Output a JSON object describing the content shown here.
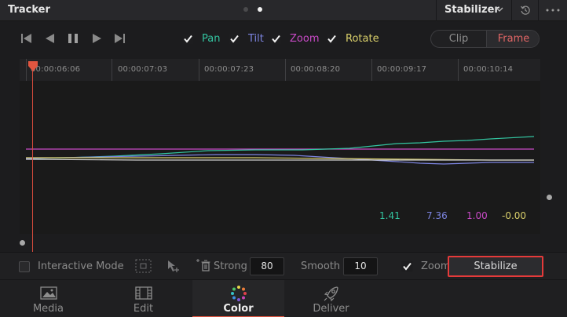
{
  "panel": {
    "title": "Tracker",
    "mode": "Stabilizer"
  },
  "transport": [
    "jump-to-start",
    "step-back",
    "pause",
    "play",
    "jump-to-end"
  ],
  "track_options": [
    {
      "label": "Pan",
      "checked": true,
      "color": "#33c4a0"
    },
    {
      "label": "Tilt",
      "checked": true,
      "color": "#7c84e0"
    },
    {
      "label": "Zoom",
      "checked": true,
      "color": "#c94ac7"
    },
    {
      "label": "Rotate",
      "checked": true,
      "color": "#d9cf6a"
    }
  ],
  "range_toggle": {
    "clip": "Clip",
    "frame": "Frame",
    "selected": "Frame"
  },
  "timeline": {
    "timecodes": [
      "00:00:06:06",
      "00:00:07:03",
      "00:00:07:23",
      "00:00:08:20",
      "00:00:09:17",
      "00:00:10:14"
    ]
  },
  "readouts": {
    "pan": "1.41",
    "tilt": "7.36",
    "zoom": "1.00",
    "rotate": "-0.00"
  },
  "options_bar": {
    "interactive_mode": "Interactive Mode",
    "interactive_checked": false,
    "strong_label": "Strong",
    "strong_value": "80",
    "smooth_label": "Smooth",
    "smooth_value": "10",
    "zoom_label": "Zoom",
    "zoom_checked": true,
    "stabilize_label": "Stabilize"
  },
  "pages": [
    {
      "label": "Media",
      "icon": "media-icon"
    },
    {
      "label": "Edit",
      "icon": "edit-icon"
    },
    {
      "label": "Color",
      "icon": "color-icon",
      "active": true
    },
    {
      "label": "Deliver",
      "icon": "deliver-icon"
    }
  ],
  "colors": {
    "accent": "#e25640",
    "playhead": "#d54b3c",
    "highlight_border": "#e53a3a"
  }
}
